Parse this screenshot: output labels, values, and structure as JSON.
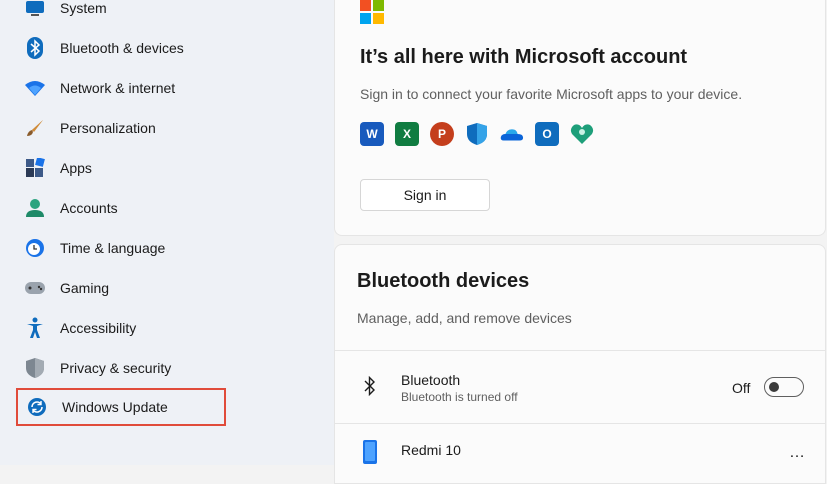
{
  "sidebar": {
    "items": [
      {
        "label": "System",
        "icon": "monitor-icon"
      },
      {
        "label": "Bluetooth & devices",
        "icon": "bluetooth-icon"
      },
      {
        "label": "Network & internet",
        "icon": "wifi-icon"
      },
      {
        "label": "Personalization",
        "icon": "brush-icon"
      },
      {
        "label": "Apps",
        "icon": "apps-icon"
      },
      {
        "label": "Accounts",
        "icon": "person-icon"
      },
      {
        "label": "Time & language",
        "icon": "clock-globe-icon"
      },
      {
        "label": "Gaming",
        "icon": "gamepad-icon"
      },
      {
        "label": "Accessibility",
        "icon": "accessibility-icon"
      },
      {
        "label": "Privacy & security",
        "icon": "shield-icon"
      },
      {
        "label": "Windows Update",
        "icon": "sync-icon"
      }
    ]
  },
  "account_card": {
    "title": "It’s all here with Microsoft account",
    "subtitle": "Sign in to connect your favorite Microsoft apps to your device.",
    "apps": [
      {
        "name": "word-icon",
        "letter": "W",
        "color": "#185abd"
      },
      {
        "name": "excel-icon",
        "letter": "X",
        "color": "#107c41"
      },
      {
        "name": "powerpoint-icon",
        "letter": "P",
        "color": "#c43e1c"
      },
      {
        "name": "defender-icon",
        "letter": "",
        "color": "#0f6cbd"
      },
      {
        "name": "onedrive-icon",
        "letter": "",
        "color": "#0a64d8"
      },
      {
        "name": "outlook-icon",
        "letter": "O",
        "color": "#0f6cbd"
      },
      {
        "name": "family-icon",
        "letter": "",
        "color": "#1e9f7a"
      }
    ],
    "signin_label": "Sign in"
  },
  "bluetooth_card": {
    "title": "Bluetooth devices",
    "subtitle": "Manage, add, and remove devices",
    "bluetooth_row": {
      "title": "Bluetooth",
      "subtitle": "Bluetooth is turned off",
      "toggle_label": "Off",
      "toggle_on": false
    },
    "device_row": {
      "title": "Redmi 10",
      "more_label": "…"
    }
  },
  "colors": {
    "accent": "#0067c0",
    "highlight_border": "#e04b3a"
  }
}
